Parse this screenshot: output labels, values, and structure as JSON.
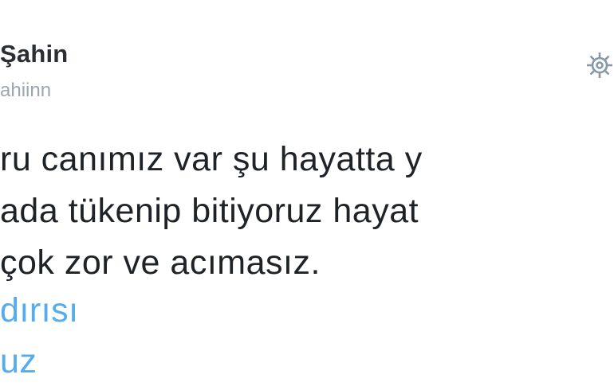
{
  "tweet": {
    "author": {
      "display_name_visible": "Şahin",
      "handle_visible": "ahiinn"
    },
    "menu_icon": "gear-icon",
    "text_lines": [
      "ru canımız var şu hayatta y",
      "ada tükenip bitiyoruz hayat",
      "çok zor ve acımasız."
    ],
    "links": [
      "dırısı",
      "uz"
    ]
  },
  "colors": {
    "name": "#2b2f33",
    "handle": "#9aa6b1",
    "text": "#1f2327",
    "link": "#55acee",
    "icon": "#8899a6"
  }
}
